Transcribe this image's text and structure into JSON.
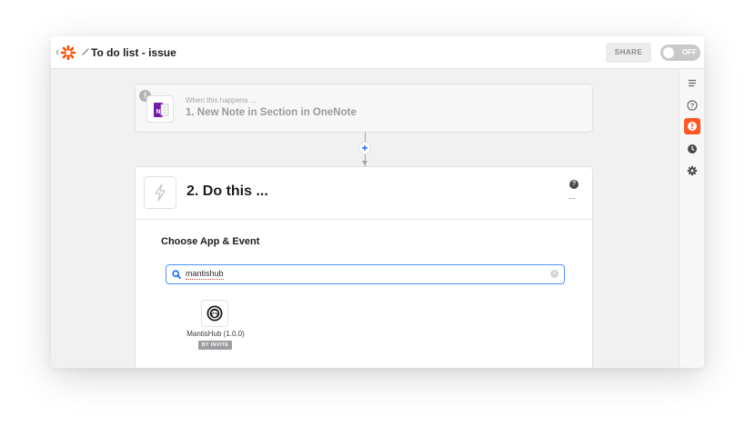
{
  "header": {
    "back_icon": "chevron-left-icon",
    "logo_icon": "zapier-logo-icon",
    "edit_icon": "pencil-icon",
    "title": "To do list - issue",
    "share_label": "SHARE",
    "toggle_label": "OFF",
    "toggle_on": false
  },
  "right_rail": {
    "items": [
      {
        "icon": "outline-icon"
      },
      {
        "icon": "help-icon"
      },
      {
        "icon": "alert-icon",
        "badge": "1",
        "active": true
      },
      {
        "icon": "history-icon"
      },
      {
        "icon": "settings-icon"
      }
    ]
  },
  "steps": {
    "trigger": {
      "caption": "When this happens ...",
      "title": "1. New Note in Section in OneNote",
      "warning_badge": "!",
      "app_icon": "onenote-icon",
      "app_icon_letter": "N"
    },
    "connector_plus": "+",
    "action": {
      "title": "2. Do this ...",
      "help_glyph": "?",
      "more_glyph": "...",
      "section_title": "Choose App & Event",
      "search_value": "mantishub",
      "clear_glyph": "×",
      "results": [
        {
          "name": "MantisHub (1.0.0)",
          "badge": "BY INVITE",
          "icon": "mantishub-icon"
        }
      ]
    }
  },
  "colors": {
    "accent": "#ff4a00",
    "alert": "#ff5722",
    "focus_blue": "#4d93ff",
    "onenote_purple": "#7719aa"
  }
}
